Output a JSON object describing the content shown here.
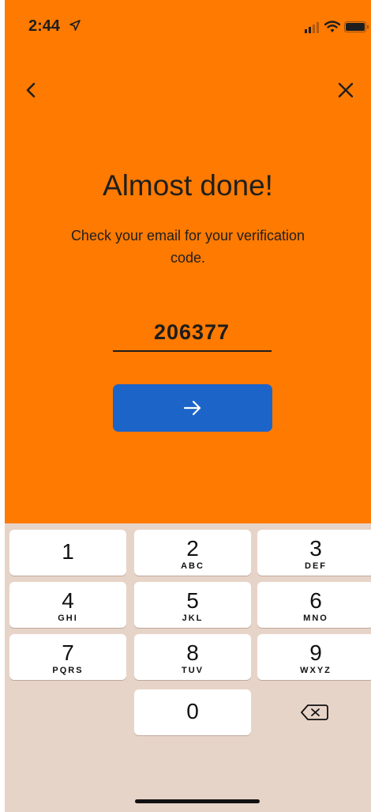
{
  "status_bar": {
    "time": "2:44"
  },
  "screen": {
    "title": "Almost done!",
    "subtitle": "Check your email for your verification code.",
    "code_value": "206377",
    "colors": {
      "background": "#ff7a00",
      "button": "#1c64c8",
      "keyboard": "#e7d4c8"
    }
  },
  "keypad": {
    "keys": [
      {
        "digit": "1",
        "letters": ""
      },
      {
        "digit": "2",
        "letters": "ABC"
      },
      {
        "digit": "3",
        "letters": "DEF"
      },
      {
        "digit": "4",
        "letters": "GHI"
      },
      {
        "digit": "5",
        "letters": "JKL"
      },
      {
        "digit": "6",
        "letters": "MNO"
      },
      {
        "digit": "7",
        "letters": "PQRS"
      },
      {
        "digit": "8",
        "letters": "TUV"
      },
      {
        "digit": "9",
        "letters": "WXYZ"
      },
      {
        "digit": "0",
        "letters": ""
      }
    ]
  }
}
